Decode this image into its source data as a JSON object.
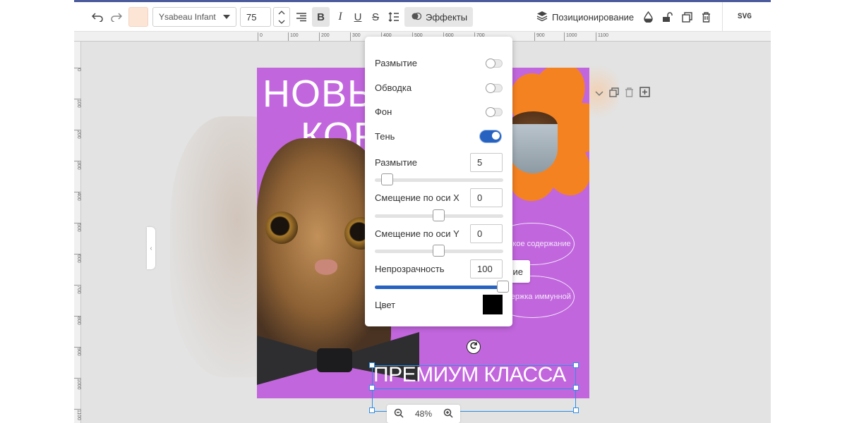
{
  "toolbar": {
    "font_family": "Ysabeau Infant",
    "font_size": "75",
    "effects_label": "Эффекты",
    "positioning_label": "Позиционирование",
    "svg_label": "SVG",
    "text_color_swatch": "#fde5d6"
  },
  "ruler": {
    "h_ticks": [
      "0",
      "100",
      "200",
      "300",
      "400",
      "500",
      "600",
      "700",
      "800",
      "900",
      "1000",
      "1100"
    ],
    "v_ticks": [
      "0",
      "100",
      "200",
      "300",
      "400",
      "500",
      "600",
      "700",
      "800",
      "900",
      "1000",
      "1100"
    ]
  },
  "poster": {
    "headline_line1": "НОВЫ",
    "headline_line2": "КОР",
    "bubble1": "Высокое содержание",
    "bubble2": "поддержка иммунной",
    "tooltip": "ование",
    "premium": "ПРЕМИУМ КЛАССА",
    "background_color": "#c266de",
    "accent_color": "#f58220"
  },
  "zoom": {
    "level": "48%"
  },
  "effects_panel": {
    "blur_label": "Размытие",
    "blur_enabled": false,
    "stroke_label": "Обводка",
    "stroke_enabled": false,
    "background_label": "Фон",
    "background_enabled": false,
    "shadow_label": "Тень",
    "shadow_enabled": true,
    "shadow_blur_label": "Размытие",
    "shadow_blur_value": "5",
    "offset_x_label": "Смещение по оси X",
    "offset_x_value": "0",
    "offset_y_label": "Смещение по оси Y",
    "offset_y_value": "0",
    "opacity_label": "Непрозрачность",
    "opacity_value": "100",
    "color_label": "Цвет",
    "color_value": "#000000",
    "accent_color": "#2762c0"
  }
}
